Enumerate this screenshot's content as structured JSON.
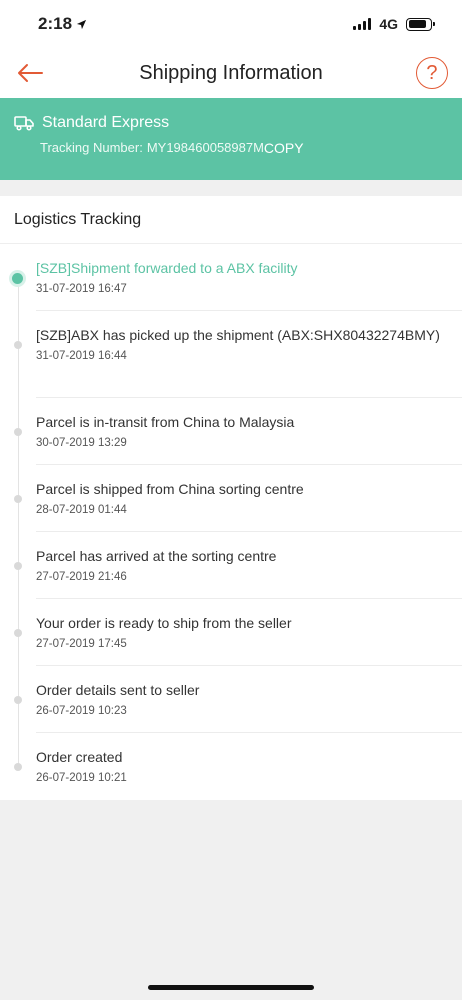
{
  "status_bar": {
    "time": "2:18",
    "network": "4G",
    "battery_level": 0.85
  },
  "header": {
    "title": "Shipping Information",
    "help_label": "?"
  },
  "shipping": {
    "service": "Standard Express",
    "tracking_label": "Tracking Number:",
    "tracking_number": "MY198460058987M",
    "copy_label": "COPY"
  },
  "logistics": {
    "title": "Logistics Tracking",
    "events": [
      {
        "description": "[SZB]Shipment forwarded to a ABX facility",
        "time": "31-07-2019 16:47"
      },
      {
        "description": "[SZB]ABX has picked up the shipment (ABX:SHX80432274BMY)",
        "time": "31-07-2019 16:44"
      },
      {
        "description": "Parcel is in-transit from China to Malaysia",
        "time": "30-07-2019 13:29"
      },
      {
        "description": "Parcel is shipped from China sorting centre",
        "time": "28-07-2019 01:44"
      },
      {
        "description": "Parcel has arrived at the sorting centre",
        "time": "27-07-2019 21:46"
      },
      {
        "description": "Your order is ready to ship from the seller",
        "time": "27-07-2019 17:45"
      },
      {
        "description": "Order details sent to seller",
        "time": "26-07-2019 10:23"
      },
      {
        "description": "Order created",
        "time": "26-07-2019 10:21"
      }
    ]
  },
  "colors": {
    "accent": "#5cc3a4",
    "brand_orange": "#e25a35"
  }
}
